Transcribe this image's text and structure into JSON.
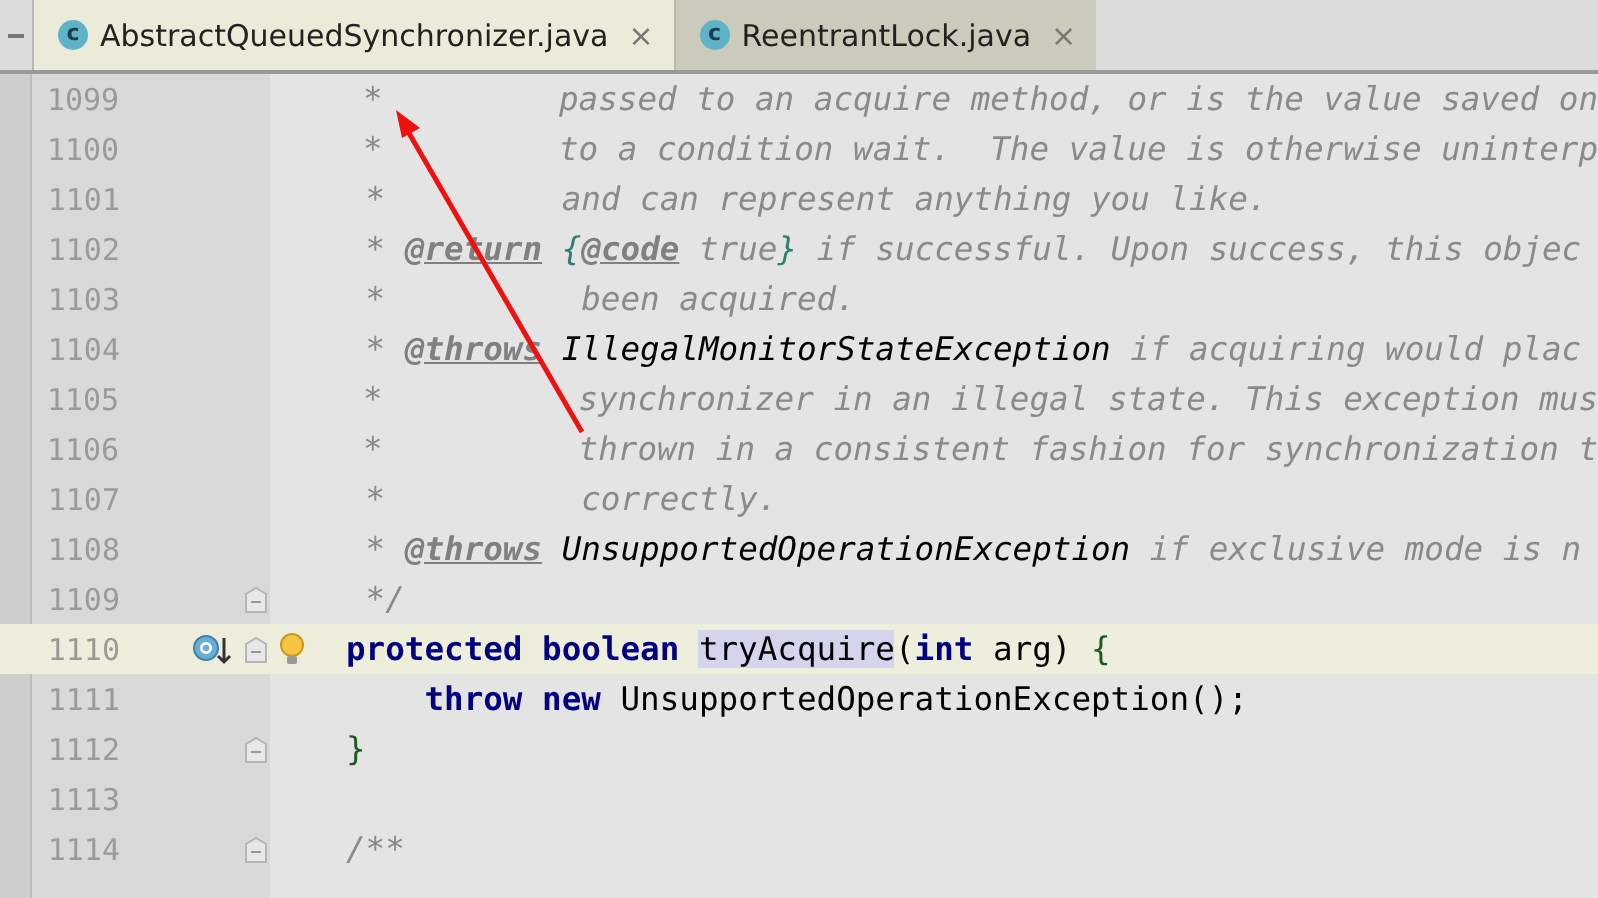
{
  "tabs": [
    {
      "icon_text": "c",
      "label": "AbstractQueuedSynchronizer.java",
      "close": "×",
      "selected": true
    },
    {
      "icon_text": "c",
      "label": "ReentrantLock.java",
      "close": "×",
      "selected": false
    }
  ],
  "lines": [
    {
      "number": "1099",
      "current": false,
      "fold": false,
      "marker": false,
      "bulb": false,
      "tokens": [
        {
          "kind": "comment",
          "text": " *         passed to an acquire method, or is the value saved on"
        }
      ]
    },
    {
      "number": "1100",
      "current": false,
      "fold": false,
      "marker": false,
      "bulb": false,
      "tokens": [
        {
          "kind": "comment",
          "text": " *         to a condition wait.  The value is otherwise uninterp"
        }
      ]
    },
    {
      "number": "1101",
      "current": false,
      "fold": false,
      "marker": false,
      "bulb": false,
      "tokens": [
        {
          "kind": "comment",
          "text": " *         and can represent anything you like."
        }
      ]
    },
    {
      "number": "1102",
      "current": false,
      "fold": false,
      "marker": false,
      "bulb": false,
      "tokens": [
        {
          "kind": "comment",
          "text": " * "
        },
        {
          "kind": "doctag",
          "text": "@return"
        },
        {
          "kind": "codebrace",
          "text": " {"
        },
        {
          "kind": "codetag",
          "text": "@code"
        },
        {
          "kind": "comment",
          "text": " true"
        },
        {
          "kind": "codebrace",
          "text": "}"
        },
        {
          "kind": "comment",
          "text": " if successful. Upon success, this objec"
        }
      ]
    },
    {
      "number": "1103",
      "current": false,
      "fold": false,
      "marker": false,
      "bulb": false,
      "tokens": [
        {
          "kind": "comment",
          "text": " *          been acquired."
        }
      ]
    },
    {
      "number": "1104",
      "current": false,
      "fold": false,
      "marker": false,
      "bulb": false,
      "tokens": [
        {
          "kind": "comment",
          "text": " * "
        },
        {
          "kind": "doctag",
          "text": "@throws"
        },
        {
          "kind": "exception",
          "text": " IllegalMonitorStateException"
        },
        {
          "kind": "comment",
          "text": " if acquiring would plac"
        }
      ]
    },
    {
      "number": "1105",
      "current": false,
      "fold": false,
      "marker": false,
      "bulb": false,
      "tokens": [
        {
          "kind": "comment",
          "text": " *          synchronizer in an illegal state. This exception mus"
        }
      ]
    },
    {
      "number": "1106",
      "current": false,
      "fold": false,
      "marker": false,
      "bulb": false,
      "tokens": [
        {
          "kind": "comment",
          "text": " *          thrown in a consistent fashion for synchronization t"
        }
      ]
    },
    {
      "number": "1107",
      "current": false,
      "fold": false,
      "marker": false,
      "bulb": false,
      "tokens": [
        {
          "kind": "comment",
          "text": " *          correctly."
        }
      ]
    },
    {
      "number": "1108",
      "current": false,
      "fold": false,
      "marker": false,
      "bulb": false,
      "tokens": [
        {
          "kind": "comment",
          "text": " * "
        },
        {
          "kind": "doctag",
          "text": "@throws"
        },
        {
          "kind": "exception",
          "text": " UnsupportedOperationException"
        },
        {
          "kind": "comment",
          "text": " if exclusive mode is n"
        }
      ]
    },
    {
      "number": "1109",
      "current": false,
      "fold": true,
      "marker": false,
      "bulb": false,
      "tokens": [
        {
          "kind": "comment",
          "text": " */"
        }
      ]
    },
    {
      "number": "1110",
      "current": true,
      "fold": true,
      "marker": true,
      "bulb": true,
      "tokens": [
        {
          "kind": "keyword",
          "text": "protected "
        },
        {
          "kind": "keyword",
          "text": "boolean "
        },
        {
          "kind": "highlight",
          "text": "tryAcquire"
        },
        {
          "kind": "plain",
          "text": "("
        },
        {
          "kind": "keyword",
          "text": "int"
        },
        {
          "kind": "plain",
          "text": " arg) "
        },
        {
          "kind": "brace",
          "text": "{"
        }
      ]
    },
    {
      "number": "1111",
      "current": false,
      "fold": false,
      "marker": false,
      "bulb": false,
      "tokens": [
        {
          "kind": "keyword",
          "text": "    throw "
        },
        {
          "kind": "keyword",
          "text": "new "
        },
        {
          "kind": "plain",
          "text": "UnsupportedOperationException();"
        }
      ]
    },
    {
      "number": "1112",
      "current": false,
      "fold": true,
      "marker": false,
      "bulb": false,
      "tokens": [
        {
          "kind": "brace",
          "text": "}"
        }
      ]
    },
    {
      "number": "1113",
      "current": false,
      "fold": false,
      "marker": false,
      "bulb": false
    },
    {
      "number": "1114",
      "current": false,
      "fold": true,
      "marker": false,
      "bulb": false,
      "tokens": [
        {
          "kind": "comment",
          "text": "/**"
        }
      ]
    }
  ]
}
